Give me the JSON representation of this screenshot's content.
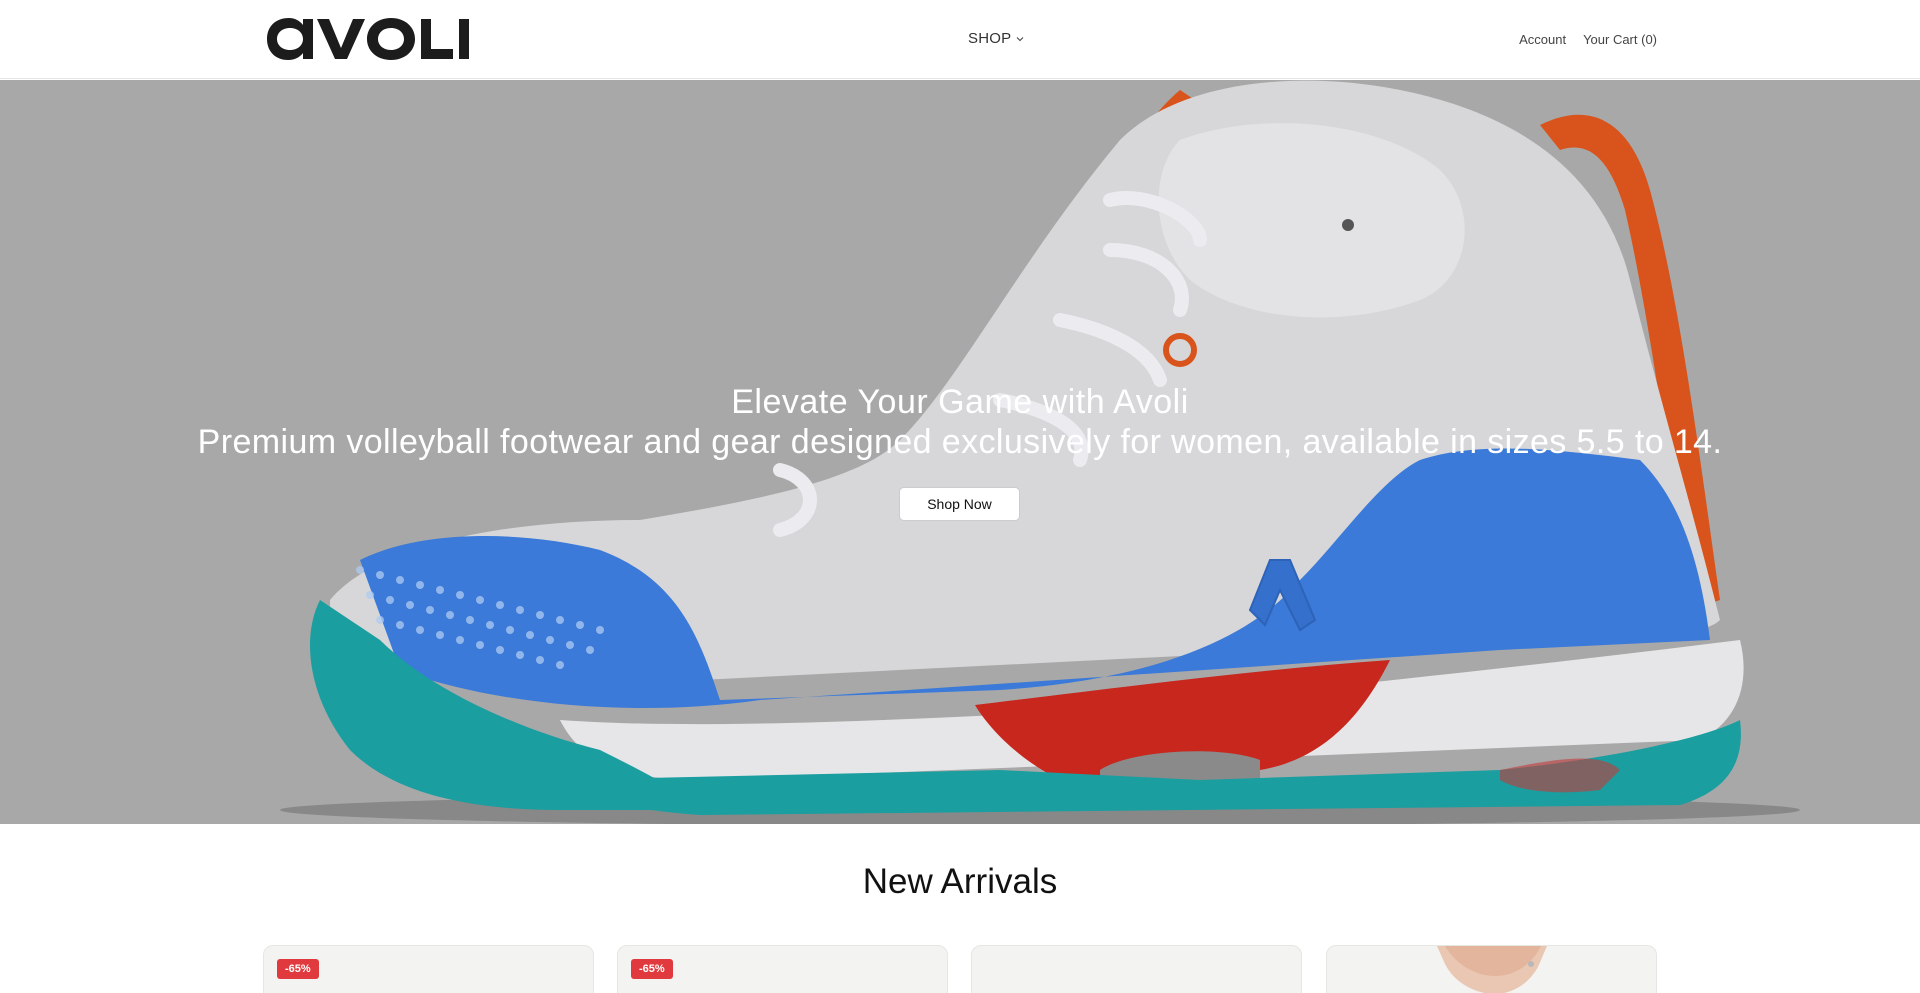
{
  "header": {
    "logo_text": "avoli",
    "nav": {
      "shop_label": "SHOP"
    },
    "account_label": "Account",
    "cart_label": "Your Cart (0)"
  },
  "hero": {
    "title": "Elevate Your Game with Avoli",
    "subtitle": "Premium volleyball footwear and gear designed exclusively for women, available in sizes 5.5 to 14.",
    "cta_label": "Shop Now",
    "image": "volleyball-shoe-white-blue-teal-red"
  },
  "new_arrivals": {
    "title": "New Arrivals",
    "cards": [
      {
        "badge": "-65%"
      },
      {
        "badge": "-65%"
      },
      {
        "badge": ""
      },
      {
        "badge": "",
        "image": "model-portrait"
      }
    ]
  },
  "colors": {
    "badge": "#e03a3e",
    "hero_overlay": "#a8a8a8",
    "shoe_blue": "#3b7ad8",
    "shoe_teal": "#1a9ea0",
    "shoe_red": "#c7271d",
    "shoe_orange": "#e05a1e"
  }
}
